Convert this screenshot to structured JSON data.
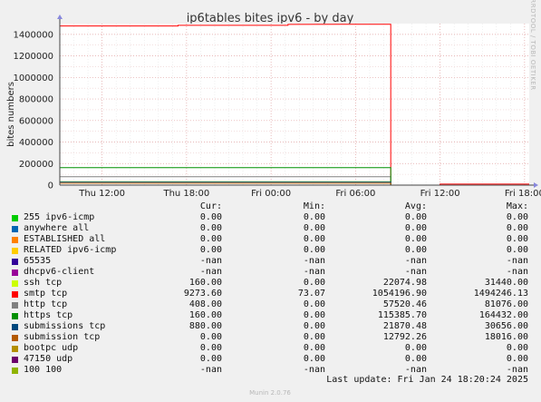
{
  "chart_data": {
    "type": "line",
    "title": "ip6tables bites ipv6 - by day",
    "ylabel": "bites numbers",
    "side_label": "RRDTOOL / TOBI OETIKER",
    "footer": "Munin 2.0.76",
    "last_update": "Last update: Fri Jan 24 18:20:24 2025",
    "ylim": [
      0,
      1500000
    ],
    "y_ticks": [
      0,
      200000,
      400000,
      600000,
      800000,
      1000000,
      1200000,
      1400000
    ],
    "y_tick_labels": [
      "0",
      "200000",
      "400000",
      "600000",
      "800000",
      "1000000",
      "1200000",
      "1400000"
    ],
    "x_ticks": [
      "Thu 12:00",
      "Thu 18:00",
      "Fri 00:00",
      "Fri 06:00",
      "Fri 12:00",
      "Fri 18:00"
    ],
    "x_range_hours": [
      -15.0,
      18.33
    ],
    "x_tick_hours": [
      -12,
      -6,
      0,
      6,
      12,
      18
    ],
    "grid": true,
    "legend_headers": {
      "cur": "Cur:",
      "min": "Min:",
      "avg": "Avg:",
      "max": "Max:"
    },
    "series": [
      {
        "name": "255 ipv6-icmp",
        "color": "#00cc00",
        "cur": "0.00",
        "min": "0.00",
        "avg": "0.00",
        "max": "0.00",
        "points": []
      },
      {
        "name": "anywhere all",
        "color": "#0066b3",
        "cur": "0.00",
        "min": "0.00",
        "avg": "0.00",
        "max": "0.00",
        "points": []
      },
      {
        "name": "ESTABLISHED all",
        "color": "#ff8000",
        "cur": "0.00",
        "min": "0.00",
        "avg": "0.00",
        "max": "0.00",
        "points": []
      },
      {
        "name": "RELATED ipv6-icmp",
        "color": "#ffcc00",
        "cur": "0.00",
        "min": "0.00",
        "avg": "0.00",
        "max": "0.00",
        "points": []
      },
      {
        "name": "65535",
        "color": "#330099",
        "cur": "-nan",
        "min": "-nan",
        "avg": "-nan",
        "max": "-nan",
        "points": []
      },
      {
        "name": "dhcpv6-client",
        "color": "#990099",
        "cur": "-nan",
        "min": "-nan",
        "avg": "-nan",
        "max": "-nan",
        "points": []
      },
      {
        "name": "ssh tcp",
        "color": "#ccff00",
        "cur": "160.00",
        "min": "0.00",
        "avg": "22074.98",
        "max": "31440.00",
        "points": [
          [
            -15,
            31000
          ],
          [
            8.5,
            31000
          ],
          [
            8.5,
            0
          ],
          [
            18.33,
            0
          ]
        ]
      },
      {
        "name": "smtp tcp",
        "color": "#ff0000",
        "cur": "9273.60",
        "min": "73.07",
        "avg": "1054196.90",
        "max": "1494246.13",
        "points": [
          [
            -15,
            1478000
          ],
          [
            -6.6,
            1478000
          ],
          [
            -6.6,
            1484000
          ],
          [
            1.2,
            1484000
          ],
          [
            1.2,
            1492000
          ],
          [
            8.5,
            1494000
          ],
          [
            8.5,
            0
          ],
          [
            12.0,
            0
          ],
          [
            12.0,
            9000
          ],
          [
            18.33,
            9000
          ]
        ]
      },
      {
        "name": "http tcp",
        "color": "#808080",
        "cur": "408.00",
        "min": "0.00",
        "avg": "57520.46",
        "max": "81076.00",
        "points": [
          [
            -15,
            78000
          ],
          [
            8.5,
            78000
          ],
          [
            8.5,
            0
          ],
          [
            18.33,
            0
          ]
        ]
      },
      {
        "name": "https tcp",
        "color": "#008f00",
        "cur": "160.00",
        "min": "0.00",
        "avg": "115385.70",
        "max": "164432.00",
        "points": [
          [
            -15,
            163000
          ],
          [
            8.5,
            163000
          ],
          [
            8.5,
            0
          ],
          [
            18.33,
            0
          ]
        ]
      },
      {
        "name": "submissions tcp",
        "color": "#00487d",
        "cur": "880.00",
        "min": "0.00",
        "avg": "21870.48",
        "max": "30656.00",
        "points": [
          [
            -15,
            29000
          ],
          [
            8.5,
            29000
          ],
          [
            8.5,
            0
          ],
          [
            18.33,
            0
          ]
        ]
      },
      {
        "name": "submission tcp",
        "color": "#b35a00",
        "cur": "0.00",
        "min": "0.00",
        "avg": "12792.26",
        "max": "18016.00",
        "points": [
          [
            -15,
            17500
          ],
          [
            8.5,
            17500
          ],
          [
            8.5,
            0
          ],
          [
            18.33,
            0
          ]
        ]
      },
      {
        "name": "bootpc udp",
        "color": "#b38f00",
        "cur": "0.00",
        "min": "0.00",
        "avg": "0.00",
        "max": "0.00",
        "points": []
      },
      {
        "name": "47150 udp",
        "color": "#6b006b",
        "cur": "0.00",
        "min": "0.00",
        "avg": "0.00",
        "max": "0.00",
        "points": []
      },
      {
        "name": "100 100",
        "color": "#8fb300",
        "cur": "-nan",
        "min": "-nan",
        "avg": "-nan",
        "max": "-nan",
        "points": []
      }
    ]
  }
}
